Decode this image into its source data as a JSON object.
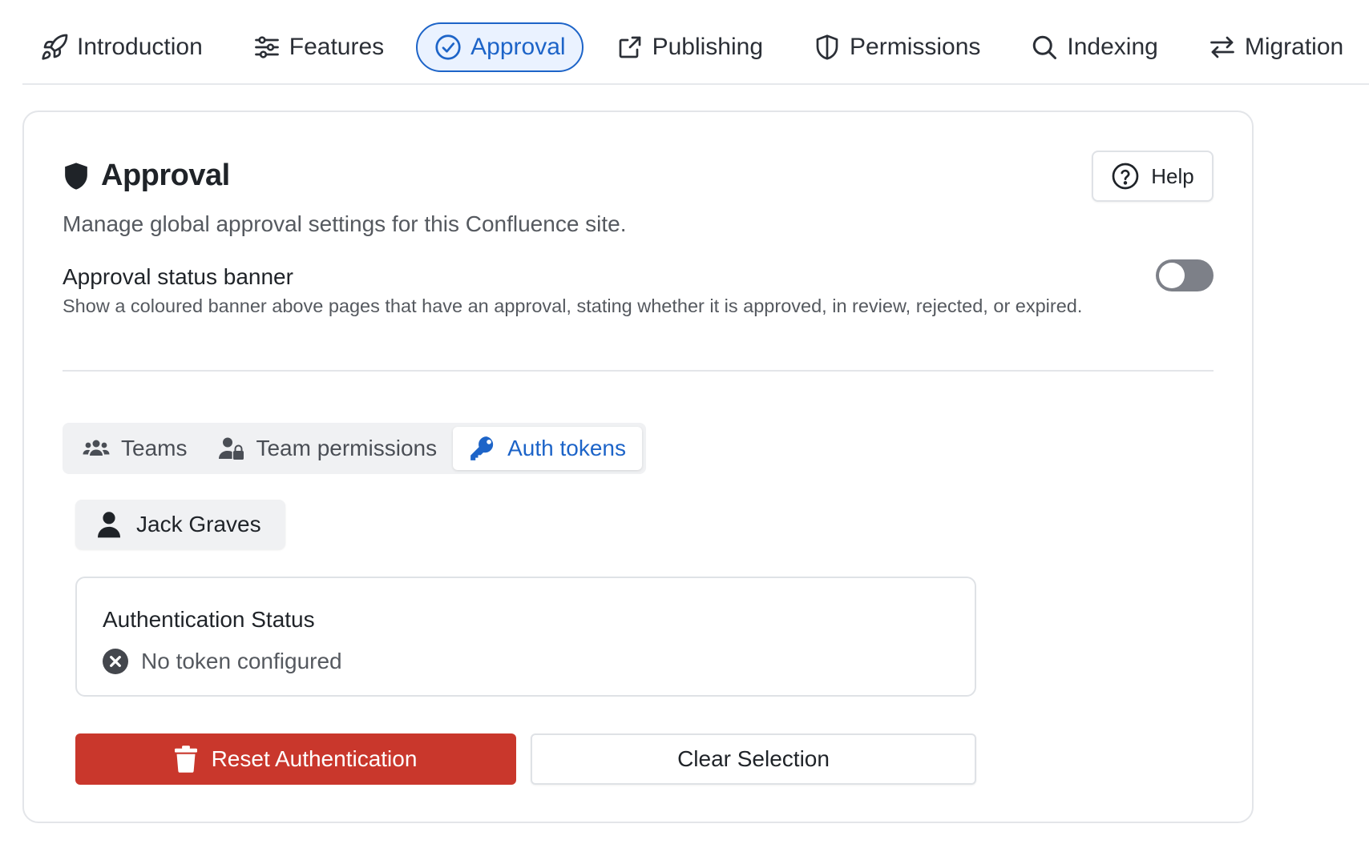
{
  "nav": {
    "items": [
      {
        "label": "Introduction",
        "icon": "rocket-icon"
      },
      {
        "label": "Features",
        "icon": "sliders-icon"
      },
      {
        "label": "Approval",
        "icon": "check-circle-icon",
        "active": true
      },
      {
        "label": "Publishing",
        "icon": "share-icon"
      },
      {
        "label": "Permissions",
        "icon": "shield-icon"
      },
      {
        "label": "Indexing",
        "icon": "search-icon"
      },
      {
        "label": "Migration",
        "icon": "arrows-swap-icon"
      }
    ]
  },
  "card": {
    "title": "Approval",
    "title_icon": "shield-filled-icon",
    "help_label": "Help",
    "subtitle": "Manage global approval settings for this Confluence site.",
    "banner_setting": {
      "label": "Approval status banner",
      "description": "Show a coloured banner above pages that have an approval, stating whether it is approved, in review, rejected, or expired.",
      "enabled": false
    },
    "tabs": [
      {
        "label": "Teams",
        "icon": "users-icon"
      },
      {
        "label": "Team permissions",
        "icon": "user-lock-icon"
      },
      {
        "label": "Auth tokens",
        "icon": "key-icon",
        "active": true
      }
    ],
    "selected_user": "Jack Graves",
    "auth": {
      "title": "Authentication Status",
      "status": "No token configured"
    },
    "reset_label": "Reset Authentication",
    "clear_label": "Clear Selection"
  },
  "colors": {
    "accent": "#1d64c8",
    "danger": "#c9372c",
    "toggle_off": "#7d8088"
  }
}
